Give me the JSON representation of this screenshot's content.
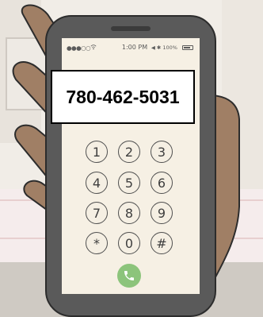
{
  "status_bar": {
    "signal": "●●●○○",
    "time": "1:00 PM",
    "right_indicators": "◀ ✱ 100%",
    "wifi_icon": "wifi-icon",
    "battery_icon": "battery-icon"
  },
  "dialer": {
    "number": "780-462-5031",
    "keys": [
      "1",
      "2",
      "3",
      "4",
      "5",
      "6",
      "7",
      "8",
      "9",
      "*",
      "0",
      "#"
    ],
    "call_icon": "phone-call-icon"
  },
  "colors": {
    "skin": "#a07f65",
    "phone_body": "#5a5a5a",
    "screen": "#f6f0e4",
    "call_button": "#8cc47b",
    "background": "#f1ede7"
  }
}
